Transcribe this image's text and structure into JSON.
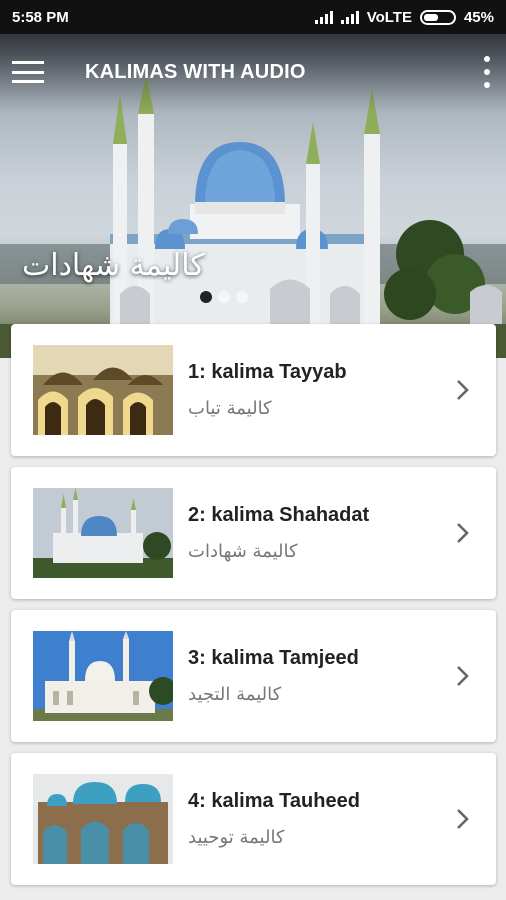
{
  "status_bar": {
    "time": "5:58 PM",
    "network": "VoLTE",
    "battery": "45%",
    "battery_level": 0.45
  },
  "app_bar": {
    "title": "KALIMAS WITH AUDIO",
    "menu_icon": "hamburger-menu-icon",
    "more_icon": "more-vertical-icon"
  },
  "hero": {
    "caption": "كاليمة شهادات",
    "slides": 3,
    "active_slide": 1
  },
  "items": [
    {
      "title": "1: kalima Tayyab",
      "subtitle": "كاليمة تياب"
    },
    {
      "title": "2: kalima Shahadat",
      "subtitle": "كاليمة شهادات"
    },
    {
      "title": "3: kalima Tamjeed",
      "subtitle": "كاليمة التجيد"
    },
    {
      "title": "4: kalima Tauheed",
      "subtitle": "كاليمة توحييد"
    }
  ],
  "colors": {
    "status_bar": "#111111",
    "background": "#ececec",
    "card": "#ffffff",
    "title_text": "#222222",
    "subtitle_text": "#777777",
    "chevron": "#666666"
  }
}
